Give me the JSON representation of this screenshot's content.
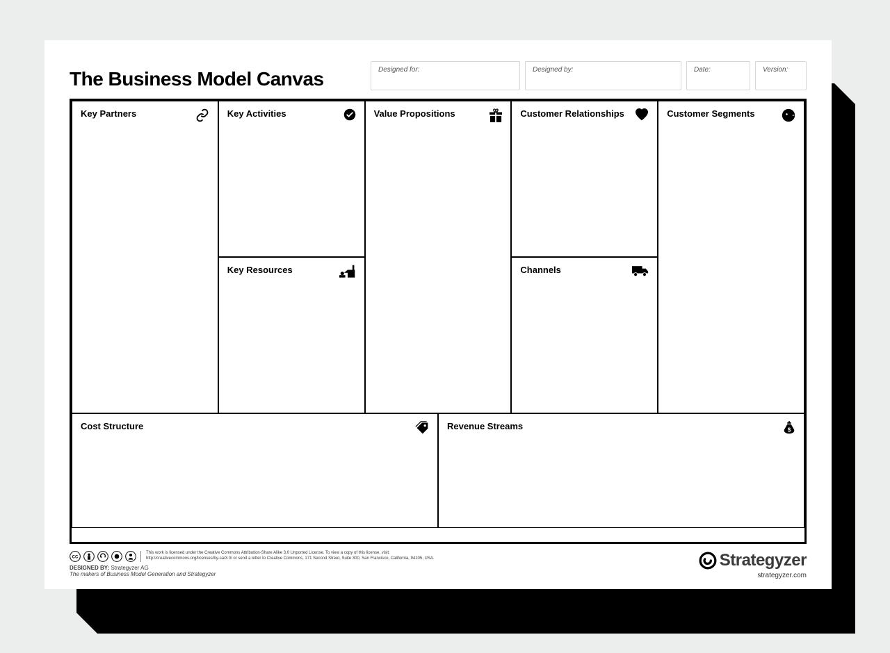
{
  "title": "The Business Model Canvas",
  "meta": {
    "designed_for_label": "Designed for:",
    "designed_by_label": "Designed by:",
    "date_label": "Date:",
    "version_label": "Version:"
  },
  "cells": {
    "key_partners": "Key Partners",
    "key_activities": "Key Activities",
    "key_resources": "Key Resources",
    "value_propositions": "Value Propositions",
    "customer_relationships": "Customer Relationships",
    "channels": "Channels",
    "customer_segments": "Customer Segments",
    "cost_structure": "Cost Structure",
    "revenue_streams": "Revenue Streams"
  },
  "footer": {
    "license_line1": "This work is licensed under the Creative Commons Attribution-Share Alike 3.0 Unported License. To view a copy of this license, visit:",
    "license_line2": "http://creativecommons.org/licenses/by-sa/3.0/ or send a letter to Creative Commons, 171 Second Street, Suite 300, San Francisco, California, 94105, USA.",
    "designed_by_label": "DESIGNED BY:",
    "designed_by_value": "Strategyzer AG",
    "designed_by_tagline": "The makers of Business Model Generation and Strategyzer",
    "brand_name": "Strategyzer",
    "brand_url": "strategyzer.com"
  }
}
